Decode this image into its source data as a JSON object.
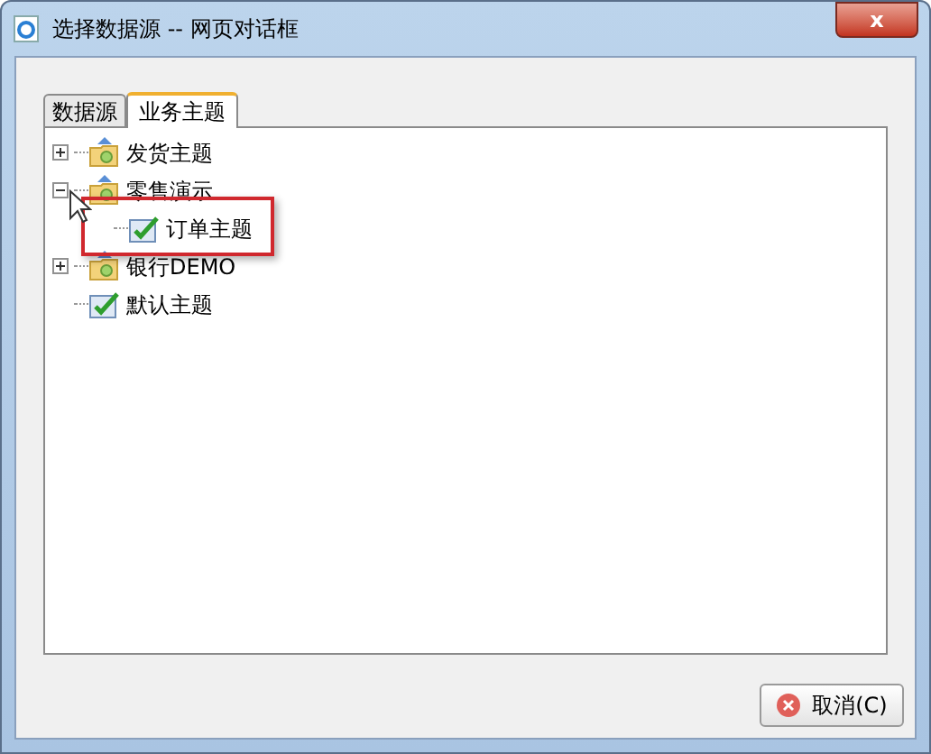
{
  "window": {
    "title": "选择数据源 -- 网页对话框",
    "close": "x"
  },
  "tabs": [
    {
      "label": "数据源",
      "selected": false
    },
    {
      "label": "业务主题",
      "selected": true
    }
  ],
  "tree": [
    {
      "label": "发货主题",
      "kind": "folder",
      "expanded": false
    },
    {
      "label": "零售演示",
      "kind": "folder",
      "expanded": true,
      "children": [
        {
          "label": "订单主题",
          "kind": "theme",
          "highlighted": true
        }
      ]
    },
    {
      "label": "银行DEMO",
      "kind": "folder",
      "expanded": false
    },
    {
      "label": "默认主题",
      "kind": "theme"
    }
  ],
  "buttons": [
    {
      "label": "取消(C)"
    }
  ]
}
